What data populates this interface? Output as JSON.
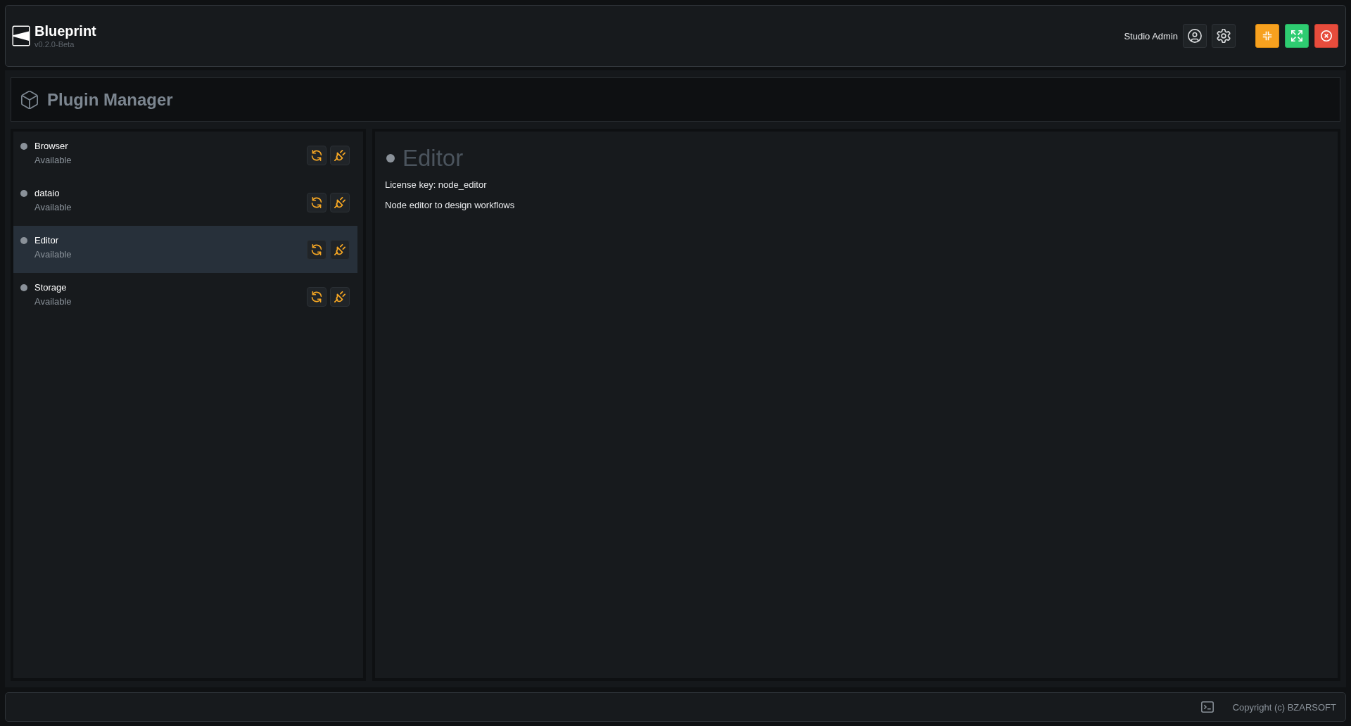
{
  "app": {
    "title": "Blueprint",
    "version": "v0.2.0-Beta"
  },
  "header": {
    "user_name": "Studio Admin"
  },
  "page": {
    "title": "Plugin Manager"
  },
  "plugins": [
    {
      "name": "Browser",
      "status": "Available",
      "selected": false
    },
    {
      "name": "dataio",
      "status": "Available",
      "selected": false
    },
    {
      "name": "Editor",
      "status": "Available",
      "selected": true
    },
    {
      "name": "Storage",
      "status": "Available",
      "selected": false
    }
  ],
  "detail": {
    "title": "Editor",
    "license": "License key: node_editor",
    "description": "Node editor to design workflows"
  },
  "status_bar": {
    "copyright": "Copyright (c) BZARSOFT"
  }
}
